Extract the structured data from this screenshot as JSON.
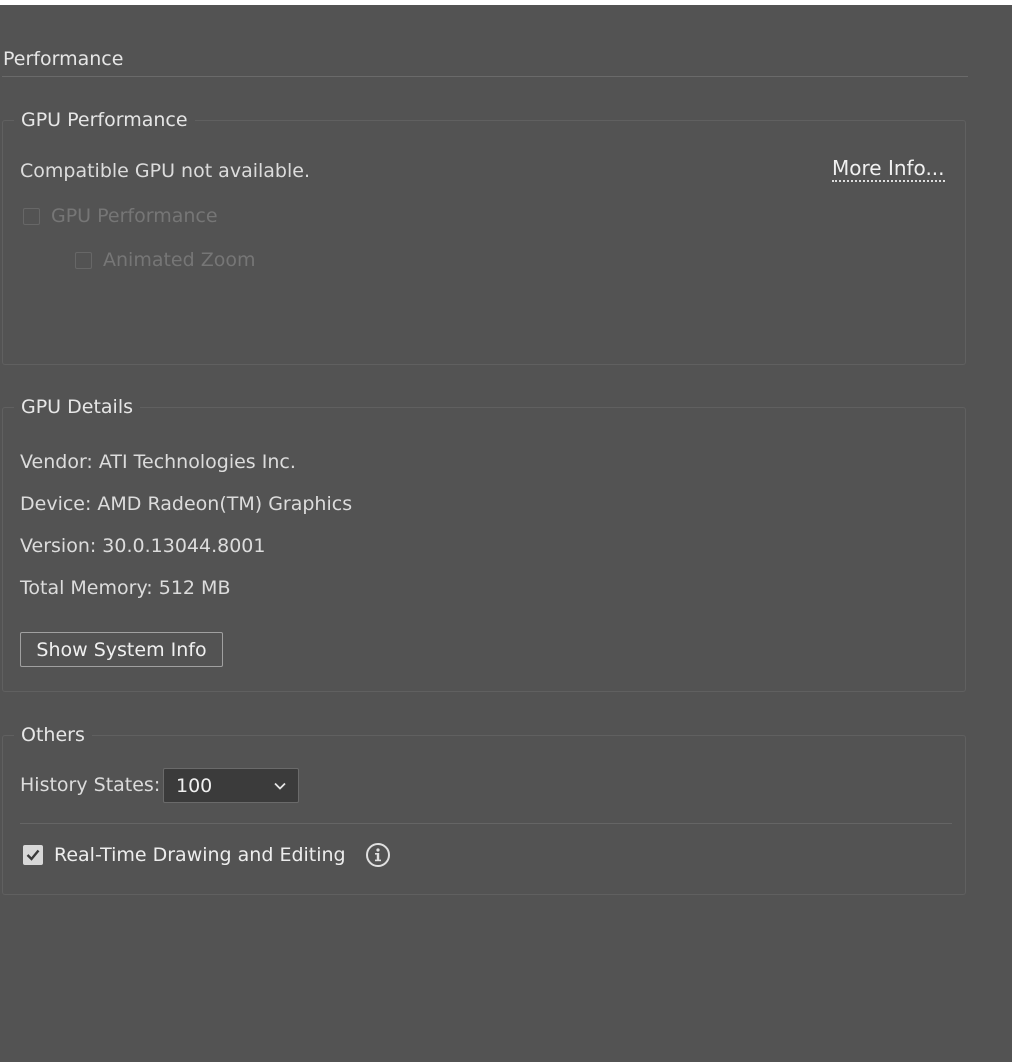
{
  "section": {
    "title": "Performance"
  },
  "gpu_performance": {
    "group_label": "GPU Performance",
    "status_text": "Compatible GPU not available.",
    "more_info_label": "More Info...",
    "gpu_performance_checkbox": {
      "label": "GPU Performance",
      "checked": false,
      "disabled": true
    },
    "animated_zoom_checkbox": {
      "label": "Animated Zoom",
      "checked": false,
      "disabled": true
    }
  },
  "gpu_details": {
    "group_label": "GPU Details",
    "vendor": "Vendor: ATI Technologies Inc.",
    "device": "Device: AMD Radeon(TM) Graphics",
    "version": "Version: 30.0.13044.8001",
    "total_memory": "Total Memory: 512 MB",
    "show_system_info_label": "Show System Info"
  },
  "others": {
    "group_label": "Others",
    "history_states_label": "History States:",
    "history_states_value": "100",
    "realtime_checkbox": {
      "label": "Real-Time Drawing and Editing",
      "checked": true,
      "disabled": false
    }
  },
  "icons": {
    "chevron": "chevron-down-icon",
    "info": "info-icon",
    "check": "check-icon"
  },
  "colors": {
    "background": "#535353",
    "border": "#606060",
    "text": "#dcdcdc",
    "disabled_text": "#767676",
    "dropdown_bg": "#3b3b3b"
  }
}
